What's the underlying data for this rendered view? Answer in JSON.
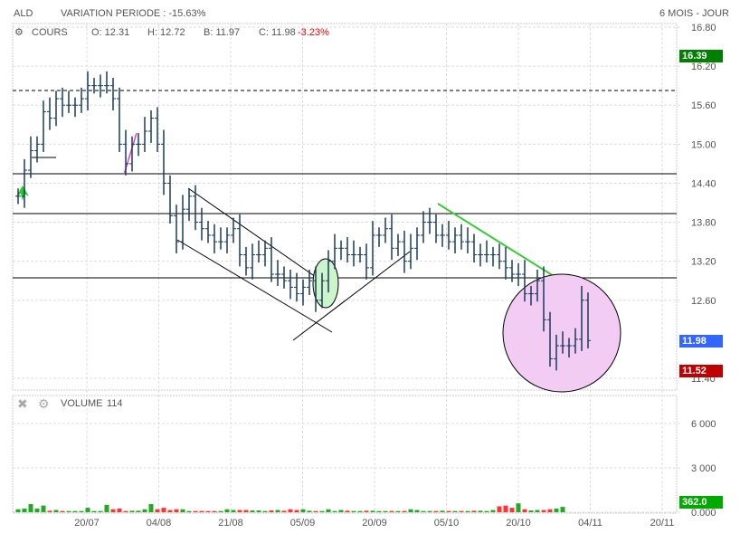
{
  "header": {
    "symbol": "ALD",
    "variation": "VARIATION PERIODE : -15.63%",
    "period": "6 MOIS - JOUR"
  },
  "legend": {
    "label": "COURS",
    "open": "O: 12.31",
    "high": "H: 12.72",
    "low": "B: 11.97",
    "close": "C: 11.98",
    "change": "-3.23%"
  },
  "volume_legend": {
    "label": "VOLUME",
    "value": "114"
  },
  "badges": {
    "high": "16.39",
    "last": "11.98",
    "low": "11.52",
    "volume": "362.0"
  },
  "colors": {
    "up": "#1a3a5c",
    "high_badge": "#008000",
    "last_badge": "#3366ff",
    "low_badge": "#c00000",
    "vol_up": "#22aa22",
    "vol_down": "#ff3333",
    "trend": "#33cc33"
  },
  "chart_data": {
    "type": "ohlc",
    "price_axis": {
      "ticks": [
        "16.80",
        "16.20",
        "15.60",
        "15.00",
        "14.40",
        "13.80",
        "13.20",
        "12.60",
        "11.40"
      ],
      "range": [
        11.2,
        16.8
      ]
    },
    "volume_axis": {
      "ticks": [
        "6 000",
        "3 000",
        "0.000"
      ],
      "range": [
        0,
        7000
      ]
    },
    "x_ticks": [
      "20/07",
      "04/08",
      "21/08",
      "05/09",
      "20/09",
      "05/10",
      "20/10",
      "04/11",
      "20/11"
    ],
    "closes": [
      14.2,
      14.6,
      14.9,
      15.0,
      15.5,
      15.4,
      15.7,
      15.6,
      15.6,
      15.6,
      15.7,
      15.9,
      15.9,
      15.9,
      15.9,
      15.7,
      15.0,
      14.7,
      15.0,
      15.0,
      15.2,
      15.4,
      15.0,
      14.4,
      13.9,
      13.5,
      14.0,
      14.2,
      13.8,
      13.7,
      13.6,
      13.5,
      13.5,
      13.6,
      13.7,
      13.3,
      13.1,
      13.3,
      13.3,
      13.4,
      13.0,
      13.0,
      12.9,
      12.8,
      12.7,
      12.8,
      12.9,
      12.6,
      12.9,
      13.2,
      13.4,
      13.4,
      13.3,
      13.3,
      13.3,
      13.1,
      13.6,
      13.6,
      13.7,
      13.4,
      13.5,
      13.2,
      13.4,
      13.6,
      13.8,
      13.8,
      13.6,
      13.6,
      13.5,
      13.6,
      13.5,
      13.5,
      13.3,
      13.3,
      13.3,
      13.3,
      13.2,
      13.1,
      13.0,
      13.0,
      12.7,
      12.7,
      12.9,
      12.3,
      11.7,
      11.9,
      11.9,
      11.9,
      12.0,
      12.6,
      11.98
    ],
    "volumes": [
      200,
      250,
      550,
      250,
      450,
      100,
      150,
      80,
      80,
      80,
      80,
      300,
      80,
      80,
      500,
      200,
      250,
      80,
      100,
      100,
      200,
      550,
      200,
      300,
      150,
      200,
      200,
      80,
      80,
      80,
      80,
      80,
      80,
      200,
      150,
      150,
      150,
      120,
      120,
      80,
      120,
      150,
      100,
      200,
      150,
      200,
      100,
      80,
      80,
      200,
      80,
      150,
      100,
      80,
      80,
      100,
      100,
      80,
      80,
      80,
      80,
      80,
      200,
      150,
      80,
      80,
      80,
      100,
      80,
      80,
      80,
      80,
      100,
      100,
      80,
      150,
      400,
      450,
      300,
      600,
      200,
      120,
      150,
      150,
      200,
      250,
      362
    ]
  }
}
